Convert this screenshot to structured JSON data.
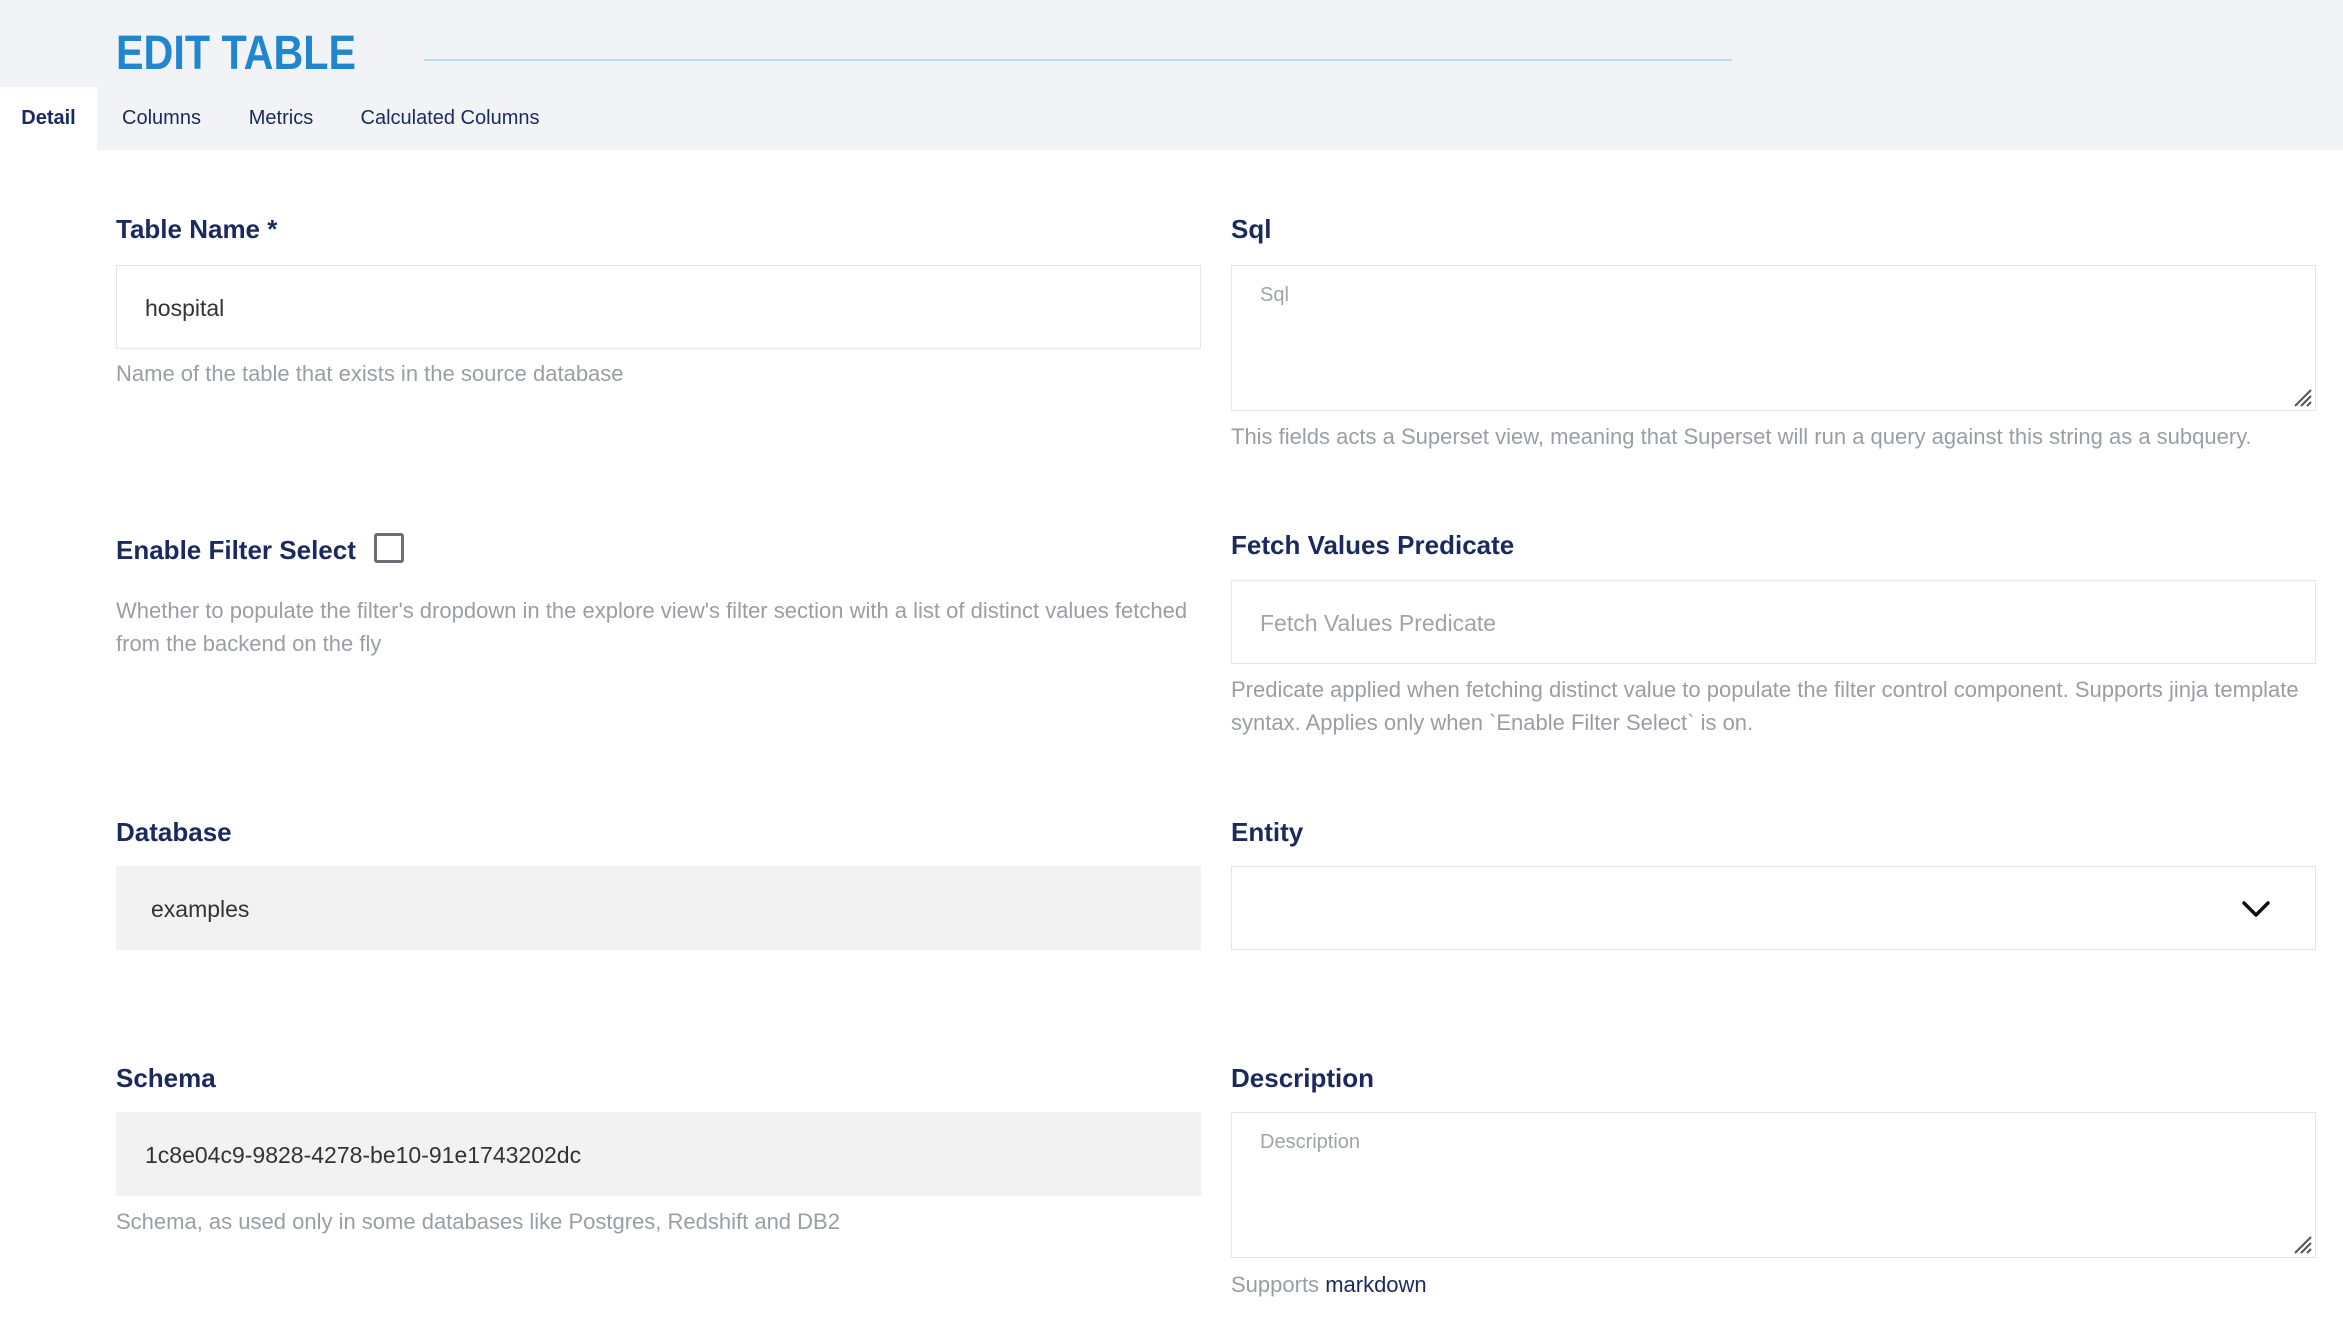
{
  "header": {
    "title": "EDIT TABLE",
    "tabs": [
      {
        "label": "Detail",
        "active": true
      },
      {
        "label": "Columns",
        "active": false
      },
      {
        "label": "Metrics",
        "active": false
      },
      {
        "label": "Calculated Columns",
        "active": false
      }
    ]
  },
  "form": {
    "table_name": {
      "label": "Table Name *",
      "value": "hospital",
      "help": "Name of the table that exists in the source database"
    },
    "sql": {
      "label": "Sql",
      "placeholder": "Sql",
      "help": "This fields acts a Superset view, meaning that Superset will run a query against this string as a subquery."
    },
    "enable_filter_select": {
      "label": "Enable Filter Select",
      "checked": false,
      "help": "Whether to populate the filter's dropdown in the explore view's filter section with a list of distinct values fetched from the backend on the fly"
    },
    "fetch_values_predicate": {
      "label": "Fetch Values Predicate",
      "placeholder": "Fetch Values Predicate",
      "help": "Predicate applied when fetching distinct value to populate the filter control component. Supports jinja template syntax. Applies only when `Enable Filter Select` is on."
    },
    "database": {
      "label": "Database",
      "value": "examples"
    },
    "entity": {
      "label": "Entity",
      "value": ""
    },
    "schema": {
      "label": "Schema",
      "value": "1c8e04c9-9828-4278-be10-91e1743202dc",
      "help": "Schema, as used only in some databases like Postgres, Redshift and DB2"
    },
    "description": {
      "label": "Description",
      "placeholder": "Description",
      "help_prefix": "Supports",
      "help_link": "markdown"
    }
  },
  "colors": {
    "title": "#1f86cf",
    "label": "#1b2a5e",
    "help": "#9a9ea3",
    "header_bg": "#f1f3f7"
  }
}
